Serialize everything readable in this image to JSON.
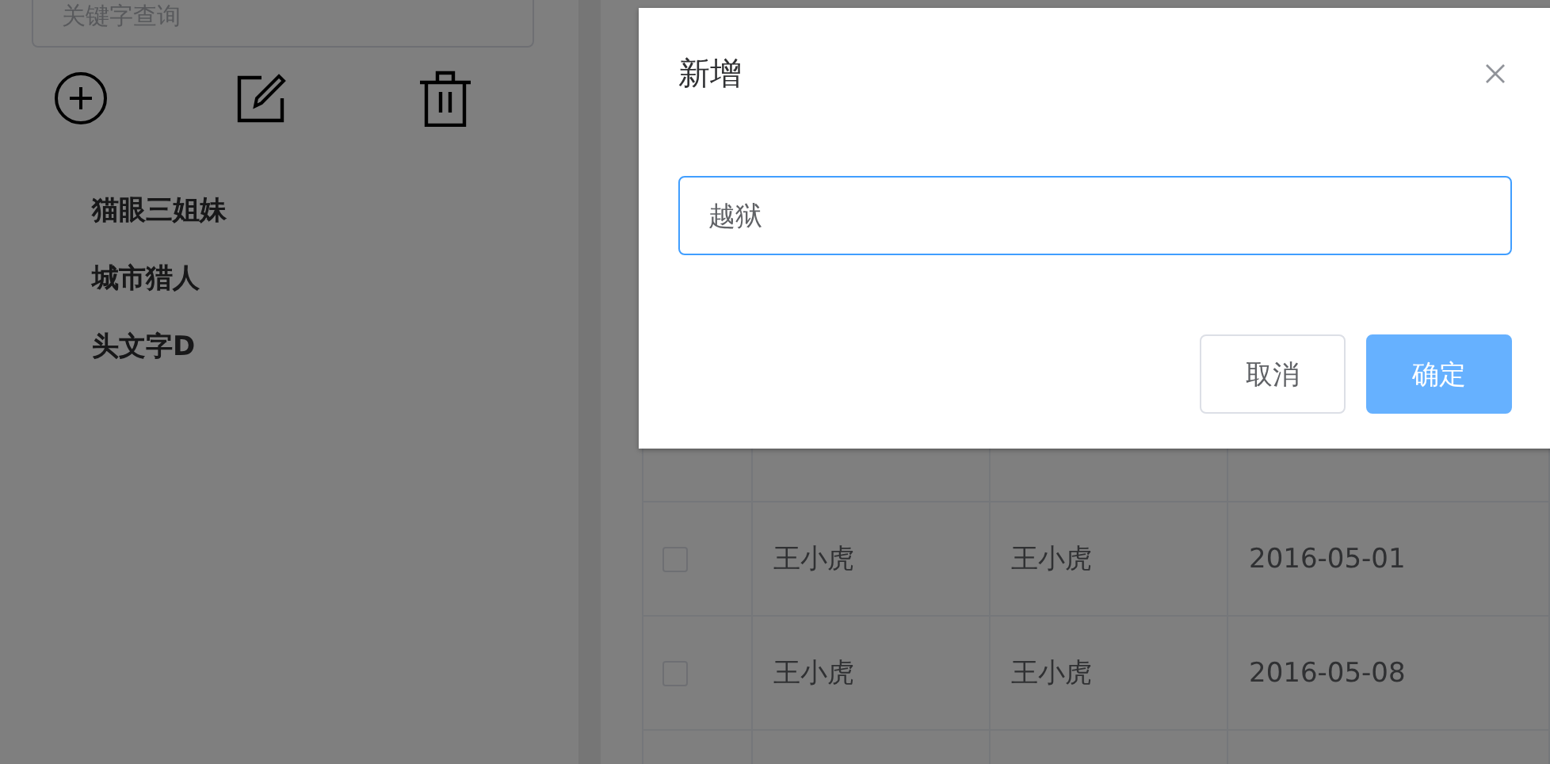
{
  "sidebar": {
    "search": {
      "placeholder": "关键字查询"
    },
    "items": [
      {
        "label": "猫眼三姐妹"
      },
      {
        "label": "城市猎人"
      },
      {
        "label": "头文字D"
      }
    ]
  },
  "table": {
    "rows": [
      {
        "checked": false,
        "cells": [
          "王小虎",
          "王小虎",
          "2016-05-01"
        ]
      },
      {
        "checked": false,
        "cells": [
          "王小虎",
          "王小虎",
          "2016-05-08"
        ]
      }
    ]
  },
  "dialog": {
    "title": "新增",
    "input": {
      "value": "越狱"
    },
    "buttons": [
      {
        "label": "取消",
        "kind": "default"
      },
      {
        "label": "确定",
        "kind": "primary"
      }
    ]
  }
}
